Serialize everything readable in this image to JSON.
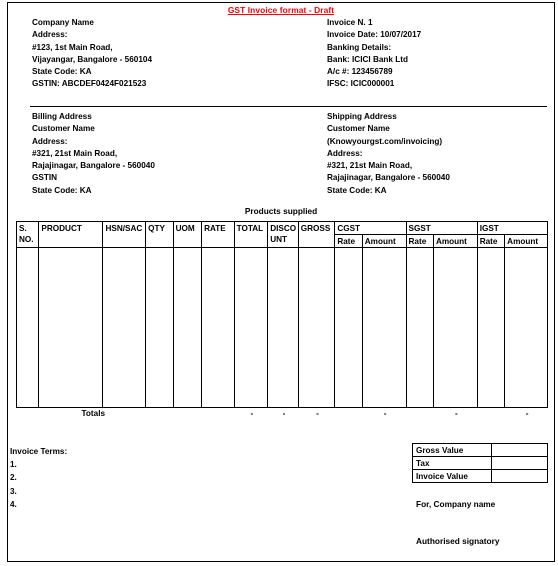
{
  "document": {
    "title": "GST Invoice format - Draft",
    "title_color": "#ff0000",
    "products_caption": "Products supplied"
  },
  "company": {
    "heading": "Company Name",
    "address_label": "Address:",
    "address_line1": "#123, 1st Main Road,",
    "address_line2": "Vijayangar, Bangalore - 560104",
    "state_code": "State Code: KA",
    "gstin": "GSTIN: ABCDEF0424F021523"
  },
  "invoice_meta": {
    "number": "Invoice N. 1",
    "date": "Invoice Date: 10/07/2017",
    "banking_heading": "Banking Details:",
    "bank": "Bank: ICICI Bank Ltd",
    "account": "A/c #: 123456789",
    "ifsc": "IFSC: ICIC000001"
  },
  "billing": {
    "heading": "Billing Address",
    "customer_name": "Customer Name",
    "address_label": "Address:",
    "address_line1": "#321, 21st Main Road,",
    "address_line2": "Rajajinagar, Bangalore - 560040",
    "gstin": "GSTIN",
    "state_code": "State Code: KA"
  },
  "shipping": {
    "heading": "Shipping Address",
    "customer_name": "Customer Name",
    "website": "(Knowyourgst.com/invoicing)",
    "address_label": "Address:",
    "address_line1": "#321, 21st Main Road,",
    "address_line2": "Rajajinagar, Bangalore - 560040",
    "state_code": "State Code: KA"
  },
  "products_table": {
    "columns": [
      {
        "label": "S. NO.",
        "line1": "S.",
        "line2": "NO."
      },
      {
        "label": "PRODUCT",
        "line1": "PRODUCT",
        "line2": ""
      },
      {
        "label": "HSN/SAC",
        "line1": "HSN/SAC",
        "line2": ""
      },
      {
        "label": "QTY",
        "line1": "QTY",
        "line2": ""
      },
      {
        "label": "UOM",
        "line1": "UOM",
        "line2": ""
      },
      {
        "label": "RATE",
        "line1": "RATE",
        "line2": ""
      },
      {
        "label": "TOTAL",
        "line1": "TOTAL",
        "line2": ""
      },
      {
        "label": "DISCOUNT",
        "line1": "DISCO",
        "line2": "UNT"
      },
      {
        "label": "GROSS",
        "line1": "GROSS",
        "line2": ""
      }
    ],
    "tax_groups": [
      {
        "label": "CGST",
        "sub": [
          "Rate",
          "Amount"
        ]
      },
      {
        "label": "SGST",
        "sub": [
          "Rate",
          "Amount"
        ]
      },
      {
        "label": "IGST",
        "sub": [
          "Rate",
          "Amount"
        ]
      }
    ],
    "rows": [],
    "totals": {
      "label": "Totals",
      "total": "-",
      "discount": "-",
      "gross": "-",
      "cgst_rate": "",
      "cgst_amount": "-",
      "sgst_rate": "",
      "sgst_amount": "-",
      "igst_rate": "",
      "igst_amount": "-"
    }
  },
  "terms": {
    "heading": "Invoice Terms:",
    "items": [
      "1.",
      "2.",
      "3.",
      "4."
    ]
  },
  "summary": {
    "rows": [
      {
        "label": "Gross Value",
        "value": ""
      },
      {
        "label": "Tax",
        "value": ""
      },
      {
        "label": "Invoice Value",
        "value": ""
      }
    ]
  },
  "signature": {
    "for_company": "For, Company name",
    "authorised": "Authorised signatory"
  }
}
